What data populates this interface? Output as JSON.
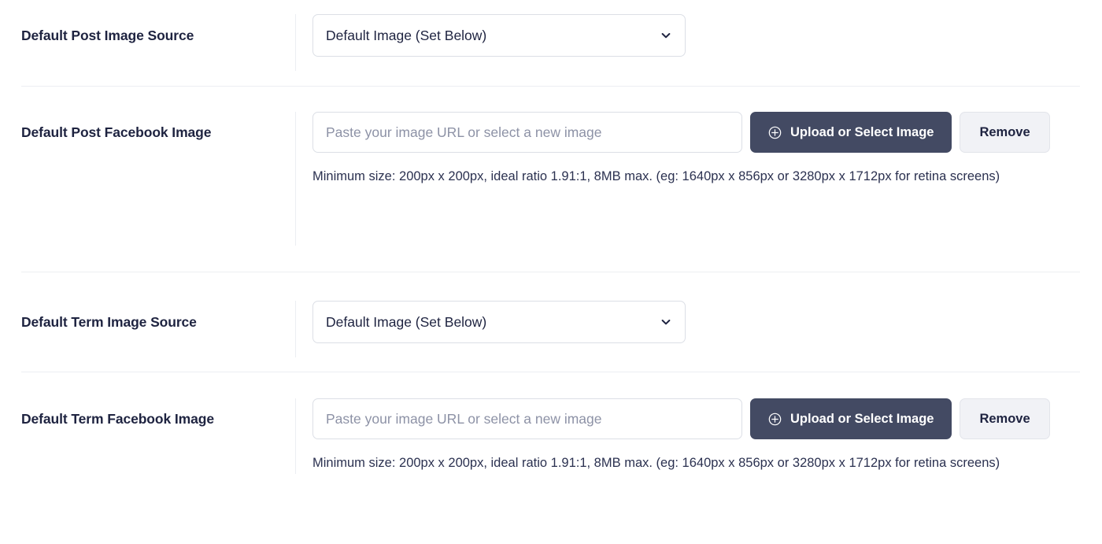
{
  "theme": {
    "accent_dark": "#434a63",
    "text_primary": "#1e2340",
    "text_muted": "#8d92a6",
    "border": "#dcdfe6",
    "divider": "#eceef2",
    "secondary_button_bg": "#f1f2f6"
  },
  "rows": [
    {
      "id": "default-post-image-source",
      "label": "Default Post Image Source",
      "type": "select",
      "select": {
        "value": "Default Image (Set Below)",
        "chevron_icon": "chevron-down-icon"
      }
    },
    {
      "id": "default-post-facebook-image",
      "label": "Default Post Facebook Image",
      "type": "image",
      "input": {
        "value": "",
        "placeholder": "Paste your image URL or select a new image"
      },
      "upload_button": {
        "label": "Upload or Select Image",
        "icon": "plus-circle-icon"
      },
      "remove_button": {
        "label": "Remove"
      },
      "help": "Minimum size: 200px x 200px, ideal ratio 1.91:1, 8MB max. (eg: 1640px x 856px or 3280px x 1712px for retina screens)"
    },
    {
      "id": "default-term-image-source",
      "label": "Default Term Image Source",
      "type": "select",
      "select": {
        "value": "Default Image (Set Below)",
        "chevron_icon": "chevron-down-icon"
      }
    },
    {
      "id": "default-term-facebook-image",
      "label": "Default Term Facebook Image",
      "type": "image",
      "input": {
        "value": "",
        "placeholder": "Paste your image URL or select a new image"
      },
      "upload_button": {
        "label": "Upload or Select Image",
        "icon": "plus-circle-icon"
      },
      "remove_button": {
        "label": "Remove"
      },
      "help": "Minimum size: 200px x 200px, ideal ratio 1.91:1, 8MB max. (eg: 1640px x 856px or 3280px x 1712px for retina screens)"
    }
  ]
}
